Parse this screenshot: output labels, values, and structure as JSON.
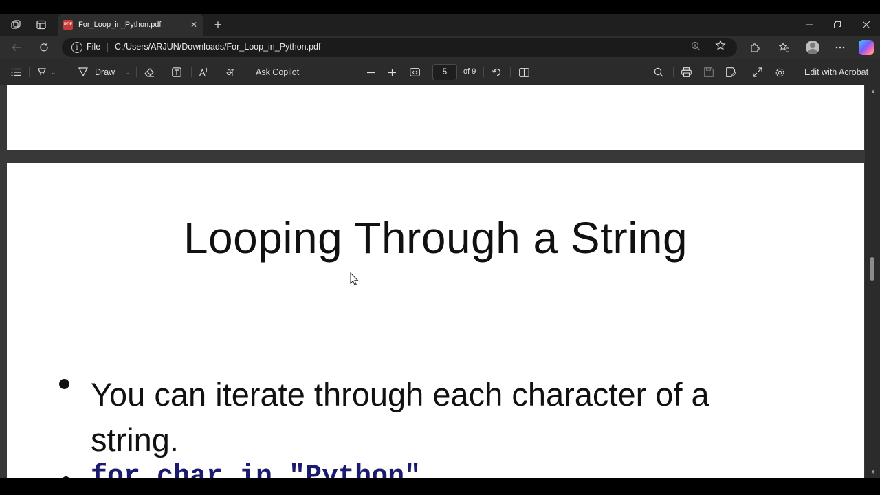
{
  "browser": {
    "tab": {
      "title": "For_Loop_in_Python.pdf",
      "icon": "pdf-file-icon"
    },
    "address": {
      "scheme_label": "File",
      "url": "C:/Users/ARJUN/Downloads/For_Loop_in_Python.pdf"
    },
    "icons": {
      "workspaces": "workspaces-icon",
      "tab_actions": "tab-actions-icon",
      "back": "back-arrow-icon",
      "refresh": "refresh-icon",
      "zoom": "zoom-icon",
      "favorite": "star-icon",
      "extensions": "puzzle-icon",
      "favorites": "favorites-icon",
      "profile": "avatar",
      "more": "more-icon",
      "copilot": "copilot-icon"
    }
  },
  "pdf_toolbar": {
    "draw_label": "Draw",
    "ask_copilot_label": "Ask Copilot",
    "page_number": "5",
    "page_of": "of 9",
    "edit_label": "Edit with Acrobat"
  },
  "document": {
    "slide_title": "Looping Through a String",
    "bullet_text": "You can iterate through each character of a string.",
    "code_line": "for char in \"Python\""
  },
  "colors": {
    "accent_pdf": "#c83a3a",
    "code_text": "#1a1a6e"
  }
}
